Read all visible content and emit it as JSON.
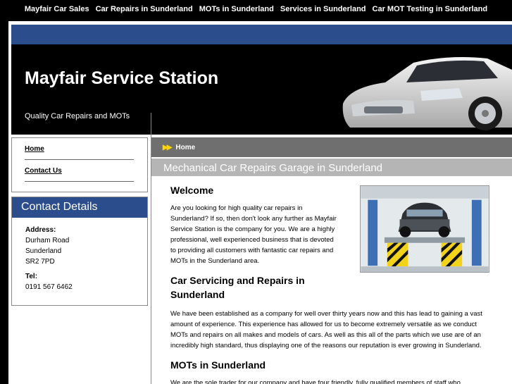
{
  "top_nav": [
    "Mayfair Car Sales",
    "Car Repairs in Sunderland",
    "MOTs in Sunderland",
    "Services in Sunderland",
    "Car MOT Testing in Sunderland"
  ],
  "header": {
    "title": "Mayfair Service Station",
    "tagline": "Quality Car Repairs and MOTs"
  },
  "sidebar": {
    "nav": [
      "Home",
      "Contact Us"
    ],
    "contact_title": "Contact Details",
    "address_label": "Address:",
    "address_lines": [
      "Durham Road",
      "Sunderland",
      "SR2 7PD"
    ],
    "tel_label": "Tel:",
    "tel": "0191 567 6462"
  },
  "main": {
    "breadcrumb": "Home",
    "heading": "Mechanical Car Repairs Garage in Sunderland",
    "welcome_title": "Welcome",
    "welcome_text": "Are you looking for high quality car repairs in Sunderland? If so, then don't look any further as Mayfair Service Station is the company for you. We are a highly professional, well experienced business that is devoted to providing all customers with fantastic car repairs and MOTs in the Sunderland area.",
    "servicing_title": "Car Servicing and Repairs in Sunderland",
    "servicing_text": "We have been established as a company for well over thirty years now and this has lead to gaining a vast amount of experience. This experience has allowed for us to become extremely versatile as we conduct MOTs and repairs on all makes and models of cars. As well as this all of the parts which we use are of an incredibly high standard, thus displaying one of the reasons our reputation is ever growing in Sunderland.",
    "mot_title": "MOTs in Sunderland",
    "mot_text": "We are the sole trader for our company and have four friendly, fully qualified members of staff who"
  },
  "colors": {
    "accent_blue": "#2b4d8c",
    "crumb_gray": "#6f6f6f",
    "heading_gray": "#b5b5b5",
    "arrow_yellow": "#ffd400"
  },
  "icons": [
    "double-chevron-right-icon"
  ]
}
